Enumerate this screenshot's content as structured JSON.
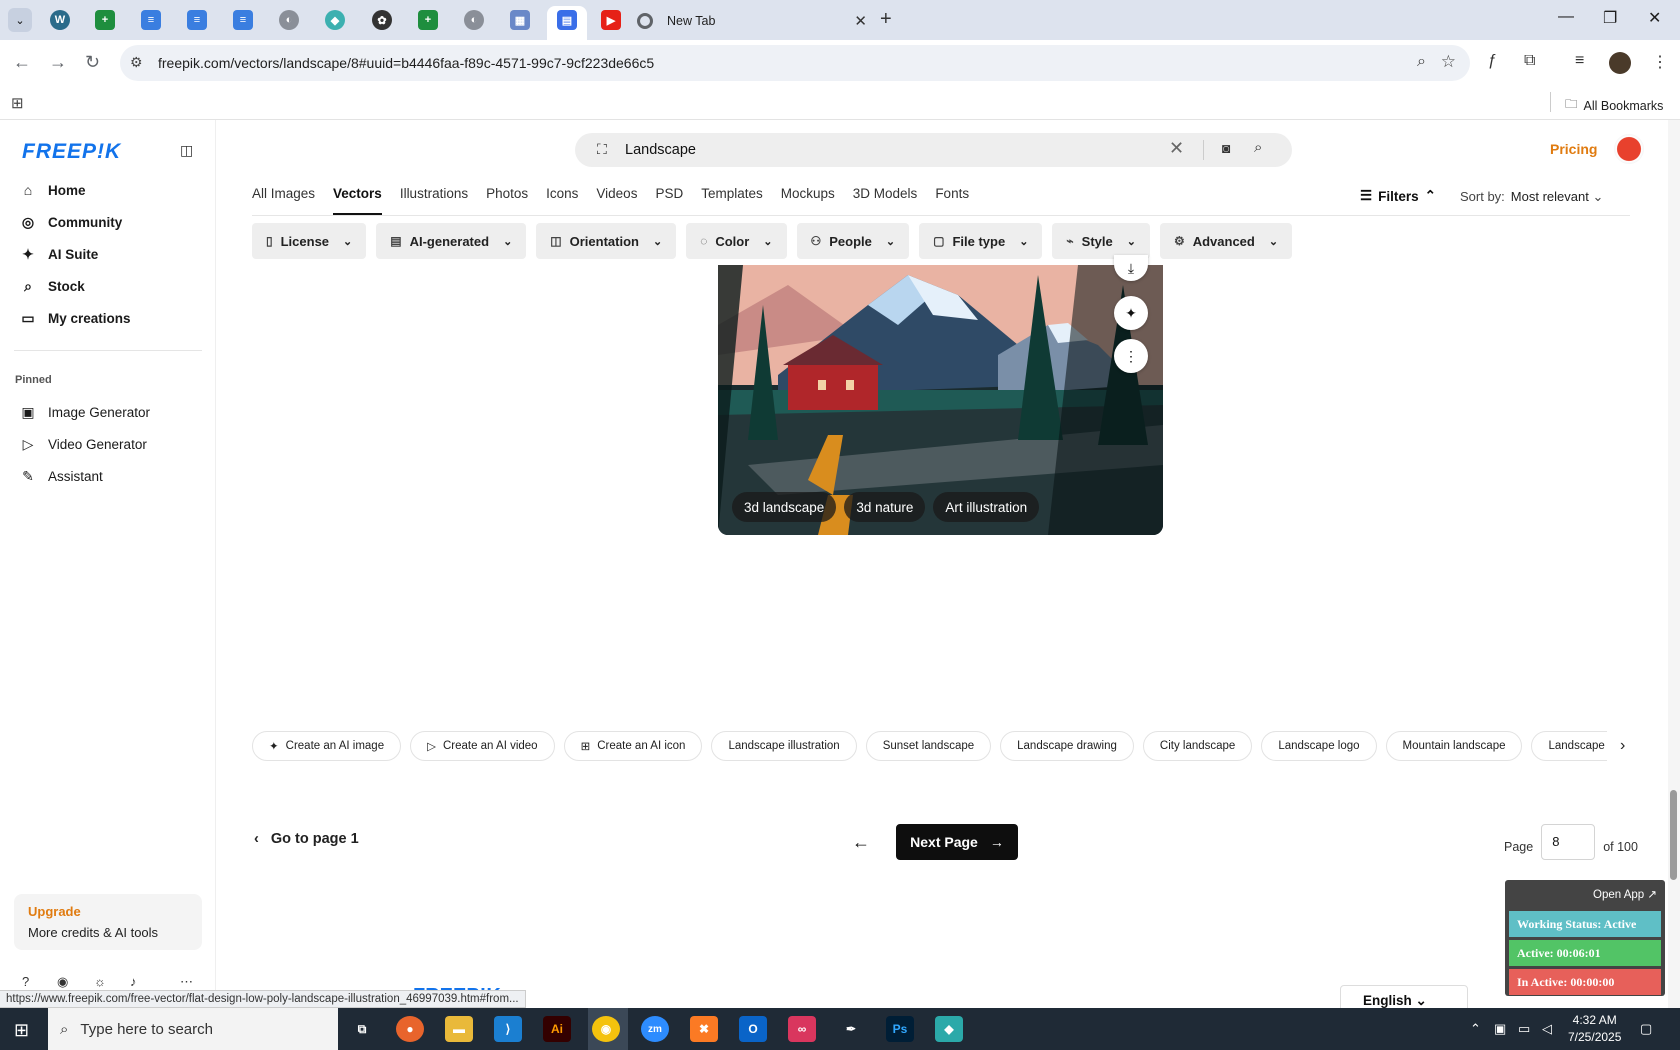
{
  "browser": {
    "active_tab_title": "New Tab",
    "url": "freepik.com/vectors/landscape/8#uuid=b4446faa-f89c-4571-99c7-9cf223de66c5",
    "bookmarks_label": "All Bookmarks",
    "status_url": "https://www.freepik.com/free-vector/flat-design-low-poly-landscape-illustration_46997039.htm#from..."
  },
  "sidebar": {
    "logo": "FREEP!K",
    "nav": [
      {
        "label": "Home",
        "icon": "home-icon"
      },
      {
        "label": "Community",
        "icon": "globe-icon"
      },
      {
        "label": "AI Suite",
        "icon": "sparkle-icon"
      },
      {
        "label": "Stock",
        "icon": "search-icon"
      },
      {
        "label": "My creations",
        "icon": "folder-icon"
      }
    ],
    "pinned_label": "Pinned",
    "pinned": [
      {
        "label": "Image Generator",
        "icon": "image-icon"
      },
      {
        "label": "Video Generator",
        "icon": "video-icon"
      },
      {
        "label": "Assistant",
        "icon": "chat-icon"
      }
    ],
    "upgrade_title": "Upgrade",
    "upgrade_text": "More credits & AI tools"
  },
  "search": {
    "query": "Landscape"
  },
  "header": {
    "pricing": "Pricing"
  },
  "categories": [
    "All Images",
    "Vectors",
    "Illustrations",
    "Photos",
    "Icons",
    "Videos",
    "PSD",
    "Templates",
    "Mockups",
    "3D Models",
    "Fonts"
  ],
  "active_category": "Vectors",
  "filters": {
    "label": "Filters",
    "sort_label": "Sort by:",
    "sort_value": "Most relevant"
  },
  "filter_chips": [
    "License",
    "AI-generated",
    "Orientation",
    "Color",
    "People",
    "File type",
    "Style",
    "Advanced"
  ],
  "image_tags": [
    "3d landscape",
    "3d nature",
    "Art illustration"
  ],
  "related": [
    "Create an AI image",
    "Create an AI video",
    "Create an AI icon",
    "Landscape illustration",
    "Sunset landscape",
    "Landscape drawing",
    "City landscape",
    "Landscape logo",
    "Mountain landscape",
    "Landscape backgr"
  ],
  "pagination": {
    "goto": "Go to page 1",
    "next": "Next Page",
    "page_label": "Page",
    "current": "8",
    "of": "of 100"
  },
  "status_widget": {
    "open_app": "Open App ↗",
    "working": "Working Status: Active",
    "active": "Active: 00:06:01",
    "inactive": "In Active: 00:00:00"
  },
  "footer": {
    "language": "English"
  },
  "taskbar": {
    "search_placeholder": "Type here to search",
    "time": "4:32 AM",
    "date": "7/25/2025"
  }
}
